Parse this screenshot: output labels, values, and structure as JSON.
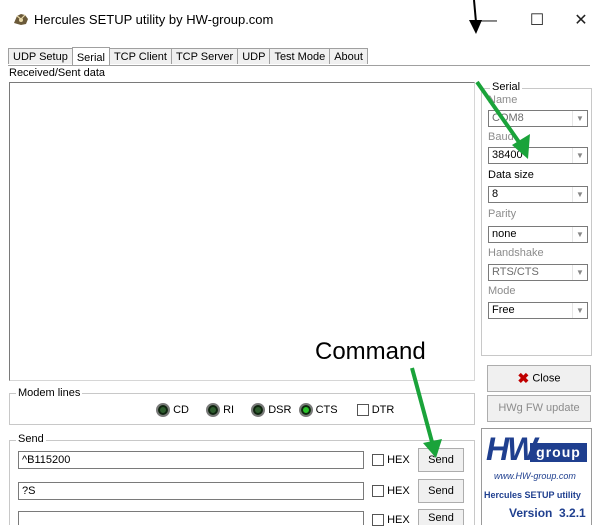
{
  "window": {
    "title": "Hercules SETUP utility by HW-group.com",
    "minimize": "—",
    "maximize": "☐",
    "close": "✕"
  },
  "tabs": [
    {
      "label": "UDP Setup",
      "active": false
    },
    {
      "label": "Serial",
      "active": true
    },
    {
      "label": "TCP Client",
      "active": false
    },
    {
      "label": "TCP Server",
      "active": false
    },
    {
      "label": "UDP",
      "active": false
    },
    {
      "label": "Test Mode",
      "active": false
    },
    {
      "label": "About",
      "active": false
    }
  ],
  "received": {
    "label": "Received/Sent data"
  },
  "serial": {
    "group_title": "Serial",
    "name_label": "Name",
    "name_value": "COM8",
    "baud_label": "Baud",
    "baud_value": "38400",
    "datasize_label": "Data size",
    "datasize_value": "8",
    "parity_label": "Parity",
    "parity_value": "none",
    "handshake_label": "Handshake",
    "handshake_value": "RTS/CTS",
    "mode_label": "Mode",
    "mode_value": "Free",
    "close_label": "Close",
    "fw_update_label": "HWg FW update"
  },
  "modem": {
    "group_title": "Modem lines",
    "cd": "CD",
    "ri": "RI",
    "dsr": "DSR",
    "cts": "CTS",
    "dtr": "DTR"
  },
  "send": {
    "group_title": "Send",
    "rows": [
      {
        "value": "^B115200",
        "hex": "HEX",
        "button": "Send"
      },
      {
        "value": "?S",
        "hex": "HEX",
        "button": "Send"
      },
      {
        "value": "",
        "hex": "HEX",
        "button": "Send"
      }
    ]
  },
  "logo": {
    "hw": "HW",
    "group": "group",
    "url": "www.HW-group.com",
    "product": "Hercules SETUP utility",
    "version": "Version  3.2.1"
  },
  "annotation": {
    "command": "Command"
  },
  "colors": {
    "arrow": "#1aa33a",
    "logo_blue": "#1f3f8f"
  }
}
